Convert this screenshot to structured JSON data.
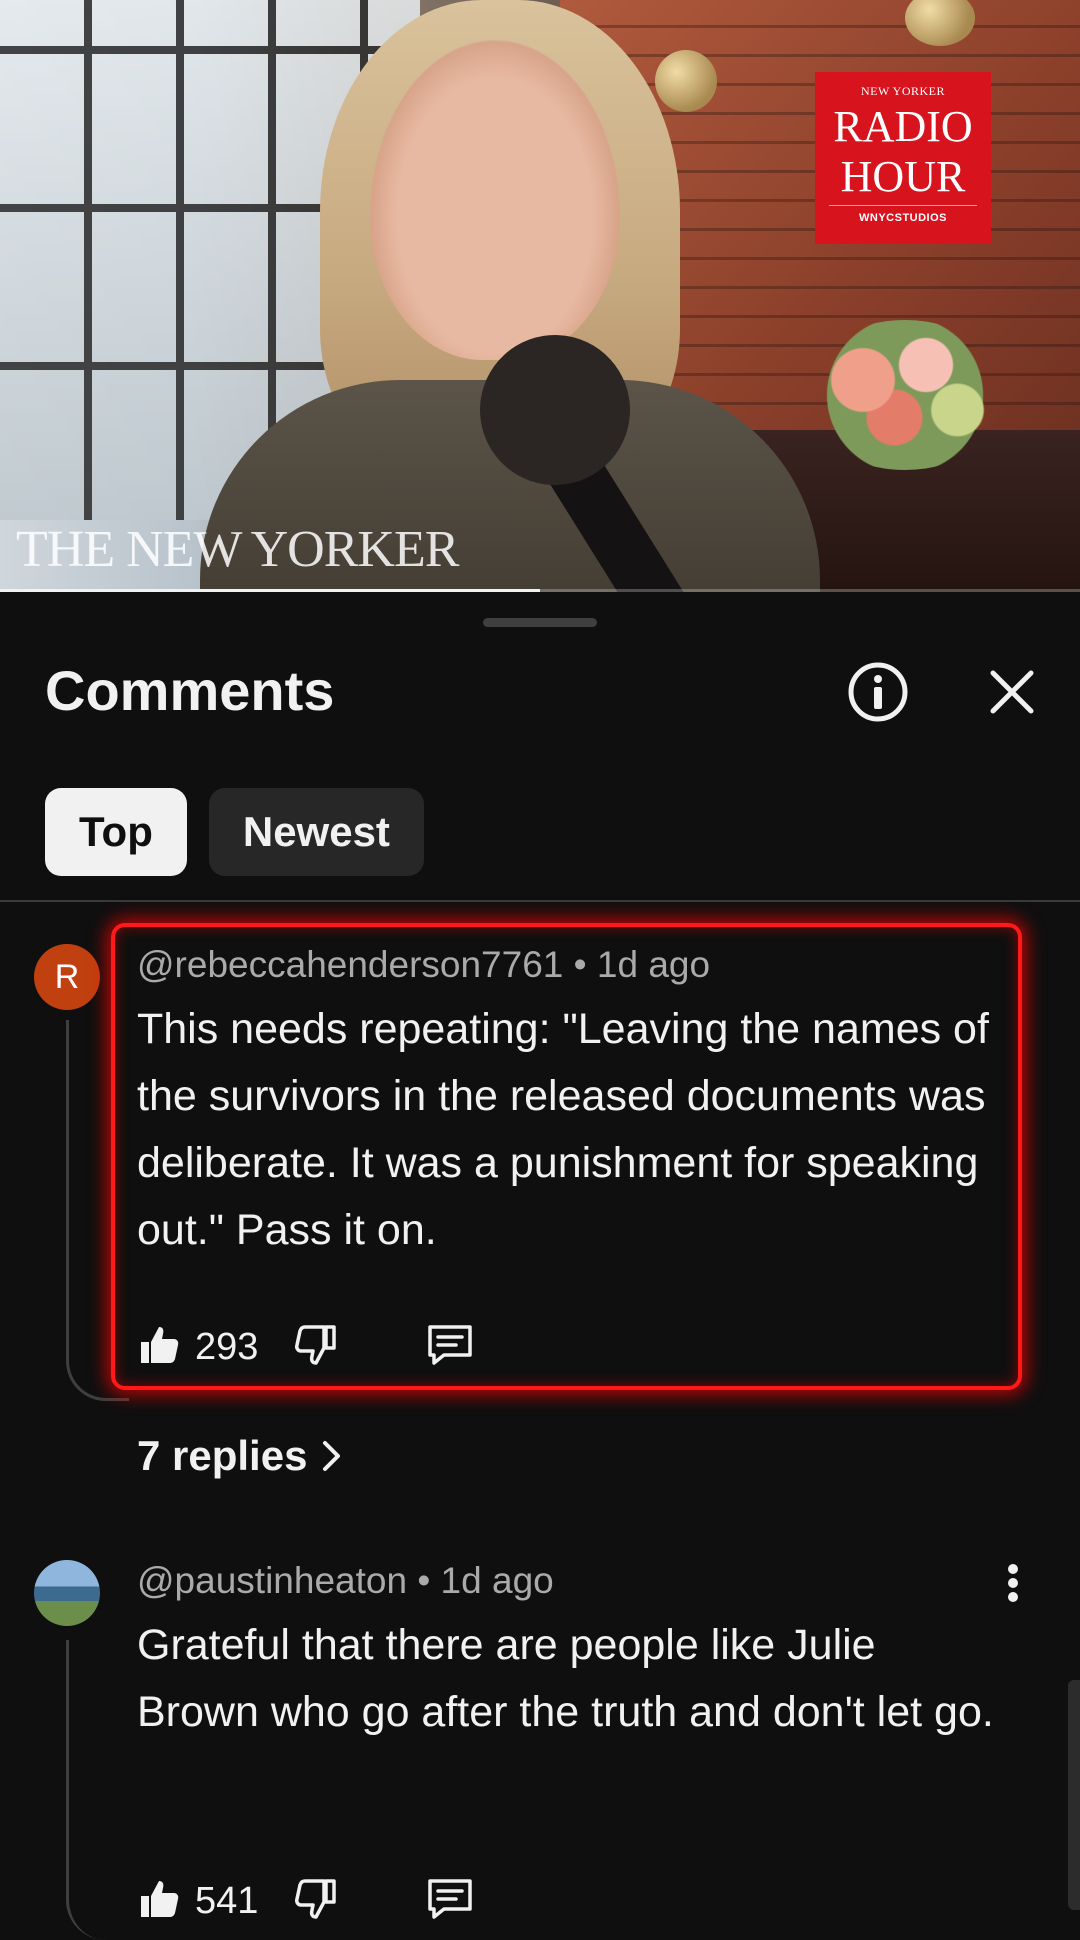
{
  "video": {
    "watermark": "THE NEW YORKER",
    "badge": {
      "small": "NEW YORKER",
      "line1": "RADIO",
      "line2": "HOUR",
      "studio": "WNYCSTUDIOS"
    },
    "progress": 0.5,
    "colors": {
      "badge": "#d7141e"
    }
  },
  "sheet": {
    "title": "Comments",
    "info_icon": "info-icon",
    "close_icon": "close-icon",
    "tabs": [
      {
        "label": "Top",
        "active": true
      },
      {
        "label": "Newest",
        "active": false
      }
    ]
  },
  "comments": [
    {
      "avatar_letter": "R",
      "avatar_color": "#c1400f",
      "meta": "@rebeccahenderson7761 • 1d ago",
      "text": "This needs repeating: \"Leaving the names of the survivors in the released documents was deliberate. It was a punishment for speaking out.\" Pass it on.",
      "likes": "293",
      "replies": "7 replies"
    },
    {
      "avatar_letter": "",
      "avatar_color": "#5b8db8",
      "meta": "@paustinheaton • 1d ago",
      "text": "Grateful that there are people like Julie Brown who go after the truth and don't let go.",
      "likes": "541"
    }
  ],
  "highlight_color": "#ff1a1a"
}
